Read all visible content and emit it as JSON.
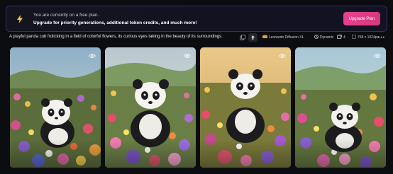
{
  "banner": {
    "line1": "You are currently on a free plan.",
    "line2": "Upgrade for priority generations, additional token credits, and much more!",
    "button_label": "Upgrade Plan",
    "icon": "lightning-bolt-icon"
  },
  "generation": {
    "prompt": "A playful panda cub frolicking in a field of colorful flowers, its curious eyes taking in the beauty of its surroundings.",
    "model": "Leonardo Diffusion XL",
    "style": "Dynamic",
    "image_count": "4",
    "dimensions": "768 x 1024px"
  },
  "images": [
    {
      "alt": "Panda cub in flower field 1",
      "action_icon": "eye-icon"
    },
    {
      "alt": "Panda cub in flower field 2",
      "action_icon": "eye-icon"
    },
    {
      "alt": "Panda cub in flower field 3",
      "action_icon": "eye-icon"
    },
    {
      "alt": "Panda cub in flower field 4",
      "action_icon": "eye-icon"
    }
  ],
  "colors": {
    "accent": "#e7418d",
    "background": "#0c0d11",
    "banner_border": "#3a2f5a"
  }
}
